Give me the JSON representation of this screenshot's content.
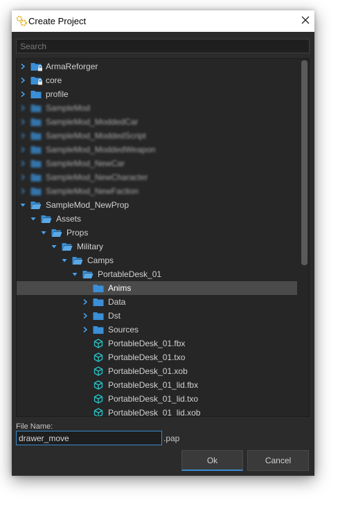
{
  "window": {
    "title": "Create Project",
    "close_symbol": "✕"
  },
  "search": {
    "placeholder": "Search"
  },
  "tree": {
    "items": [
      {
        "label": "ArmaReforger",
        "arrow": "collapsed",
        "icon": "folder-lock-icon",
        "blurred": false,
        "selected": false
      },
      {
        "label": "core",
        "arrow": "collapsed",
        "icon": "folder-lock-icon",
        "blurred": false,
        "selected": false
      },
      {
        "label": "profile",
        "arrow": "collapsed",
        "icon": "folder-icon",
        "blurred": false,
        "selected": false
      },
      {
        "label": "SampleMod",
        "arrow": "collapsed",
        "icon": "folder-icon",
        "blurred": true,
        "selected": false
      },
      {
        "label": "SampleMod_ModdedCar",
        "arrow": "collapsed",
        "icon": "folder-icon",
        "blurred": true,
        "selected": false
      },
      {
        "label": "SampleMod_ModdedScript",
        "arrow": "collapsed",
        "icon": "folder-icon",
        "blurred": true,
        "selected": false
      },
      {
        "label": "SampleMod_ModdedWeapon",
        "arrow": "collapsed",
        "icon": "folder-icon",
        "blurred": true,
        "selected": false
      },
      {
        "label": "SampleMod_NewCar",
        "arrow": "collapsed",
        "icon": "folder-icon",
        "blurred": true,
        "selected": false
      },
      {
        "label": "SampleMod_NewCharacter",
        "arrow": "collapsed",
        "icon": "folder-icon",
        "blurred": true,
        "selected": false
      },
      {
        "label": "SampleMod_NewFaction",
        "arrow": "collapsed",
        "icon": "folder-icon",
        "blurred": true,
        "selected": false
      },
      {
        "label": "SampleMod_NewProp",
        "arrow": "expanded",
        "icon": "folder-open-icon",
        "blurred": false,
        "selected": false
      },
      {
        "label": "Assets",
        "arrow": "expanded",
        "icon": "folder-open-icon",
        "blurred": false,
        "selected": false
      },
      {
        "label": "Props",
        "arrow": "expanded",
        "icon": "folder-open-icon",
        "blurred": false,
        "selected": false
      },
      {
        "label": "Military",
        "arrow": "expanded",
        "icon": "folder-open-icon",
        "blurred": false,
        "selected": false
      },
      {
        "label": "Camps",
        "arrow": "expanded",
        "icon": "folder-open-icon",
        "blurred": false,
        "selected": false
      },
      {
        "label": "PortableDesk_01",
        "arrow": "expanded",
        "icon": "folder-open-icon",
        "blurred": false,
        "selected": false
      },
      {
        "label": "Anims",
        "arrow": "none",
        "icon": "folder-icon",
        "blurred": false,
        "selected": true
      },
      {
        "label": "Data",
        "arrow": "collapsed",
        "icon": "folder-icon",
        "blurred": false,
        "selected": false
      },
      {
        "label": "Dst",
        "arrow": "collapsed",
        "icon": "folder-icon",
        "blurred": false,
        "selected": false
      },
      {
        "label": "Sources",
        "arrow": "collapsed",
        "icon": "folder-icon",
        "blurred": false,
        "selected": false
      },
      {
        "label": "PortableDesk_01.fbx",
        "arrow": "none",
        "icon": "cube-icon",
        "blurred": false,
        "selected": false
      },
      {
        "label": "PortableDesk_01.txo",
        "arrow": "none",
        "icon": "cube-icon",
        "blurred": false,
        "selected": false
      },
      {
        "label": "PortableDesk_01.xob",
        "arrow": "none",
        "icon": "cube-icon",
        "blurred": false,
        "selected": false
      },
      {
        "label": "PortableDesk_01_lid.fbx",
        "arrow": "none",
        "icon": "cube-icon",
        "blurred": false,
        "selected": false
      },
      {
        "label": "PortableDesk_01_lid.txo",
        "arrow": "none",
        "icon": "cube-icon",
        "blurred": false,
        "selected": false
      },
      {
        "label": "PortableDesk_01_lid.xob",
        "arrow": "none",
        "icon": "cube-icon",
        "blurred": false,
        "selected": false
      }
    ]
  },
  "file_name": {
    "label": "File Name:",
    "value": "drawer_move",
    "extension": ".pap"
  },
  "buttons": {
    "ok": "Ok",
    "cancel": "Cancel"
  },
  "colors": {
    "accent": "#3b8ad1",
    "folder": "#3a8fd6",
    "cube": "#27c3c9",
    "background": "#2b2b2b"
  }
}
